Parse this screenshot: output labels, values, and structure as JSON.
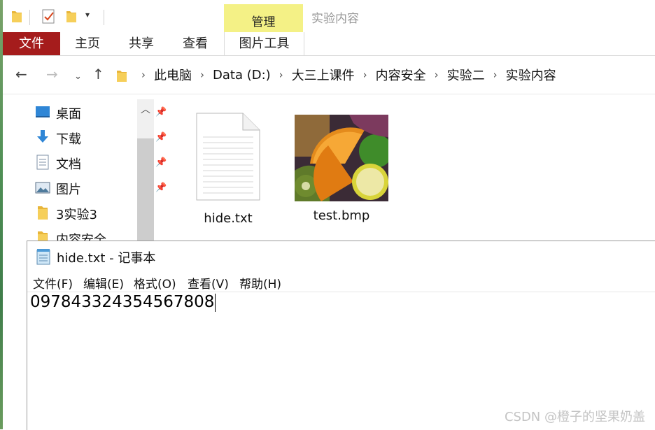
{
  "window": {
    "title": "实验内容",
    "context_tab_header": "管理"
  },
  "ribbon": {
    "tabs": {
      "file": "文件",
      "home": "主页",
      "share": "共享",
      "view": "查看",
      "picture_tools": "图片工具"
    }
  },
  "address": {
    "breadcrumbs": [
      "此电脑",
      "Data (D:)",
      "大三上课件",
      "内容安全",
      "实验二",
      "实验内容"
    ]
  },
  "navpane": {
    "items": [
      {
        "label": "桌面",
        "icon": "desktop-icon",
        "pinned": true
      },
      {
        "label": "下载",
        "icon": "download-icon",
        "pinned": true
      },
      {
        "label": "文档",
        "icon": "document-icon",
        "pinned": true
      },
      {
        "label": "图片",
        "icon": "pictures-icon",
        "pinned": true
      },
      {
        "label": "3实验3",
        "icon": "folder-icon",
        "pinned": false
      },
      {
        "label": "内容安全",
        "icon": "folder-icon",
        "pinned": false
      }
    ]
  },
  "files": [
    {
      "name": "hide.txt",
      "icon": "text-file-icon"
    },
    {
      "name": "test.bmp",
      "icon": "image-thumbnail-icon"
    }
  ],
  "notepad": {
    "title": "hide.txt - 记事本",
    "menu": [
      "文件(F)",
      "编辑(E)",
      "格式(O)",
      "查看(V)",
      "帮助(H)"
    ],
    "content": "097843324354567808"
  },
  "watermark": "CSDN @橙子的坚果奶盖",
  "colors": {
    "file_tab": "#a51c1c",
    "context_header": "#f4f186"
  }
}
